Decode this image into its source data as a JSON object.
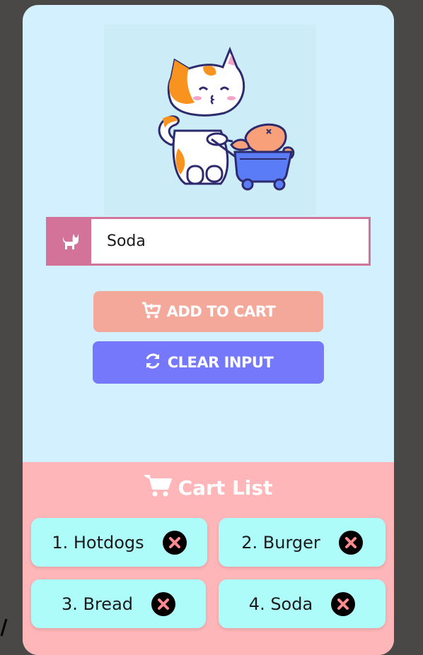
{
  "input": {
    "value": "Soda",
    "icon": "cat-icon"
  },
  "buttons": {
    "add_to_cart": "ADD TO CART",
    "clear_input": "CLEAR INPUT"
  },
  "cart": {
    "title": "Cart List",
    "items": [
      {
        "label": "1. Hotdogs"
      },
      {
        "label": "2. Burger"
      },
      {
        "label": "3. Bread"
      },
      {
        "label": "4. Soda"
      }
    ]
  },
  "colors": {
    "page_bg": "#4a4847",
    "card_bg": "#d2f0fd",
    "accent_pink": "#d4739a",
    "add_button": "#f4a89a",
    "clear_button": "#7678fb",
    "cart_bg": "#ffb6b8",
    "cart_item_bg": "#aefcf9",
    "remove_x": "#ff8a8f"
  }
}
